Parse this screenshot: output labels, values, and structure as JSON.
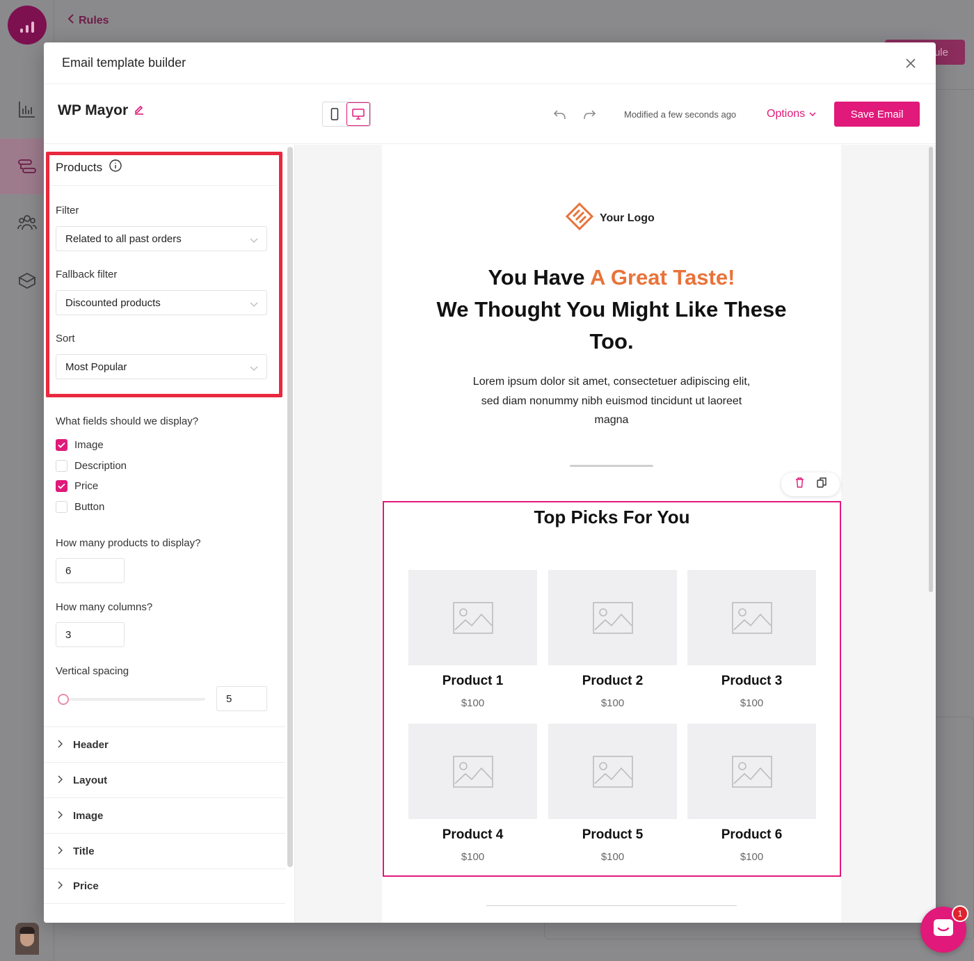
{
  "app": {
    "back_label": "Rules",
    "background_button_partial": "ule"
  },
  "modal": {
    "title": "Email template builder"
  },
  "toolbar": {
    "email_name": "WP Mayor",
    "modified_text": "Modified a few seconds ago",
    "options_label": "Options",
    "save_label": "Save Email",
    "active_view": "desktop"
  },
  "panel": {
    "section_title": "Products",
    "filter_label": "Filter",
    "filter_value": "Related to all past orders",
    "fallback_label": "Fallback filter",
    "fallback_value": "Discounted products",
    "sort_label": "Sort",
    "sort_value": "Most Popular",
    "fields_question": "What fields should we display?",
    "fields": [
      {
        "label": "Image",
        "checked": true
      },
      {
        "label": "Description",
        "checked": false
      },
      {
        "label": "Price",
        "checked": true
      },
      {
        "label": "Button",
        "checked": false
      }
    ],
    "count_label": "How many products to display?",
    "count_value": "6",
    "columns_label": "How many columns?",
    "columns_value": "3",
    "spacing_label": "Vertical spacing",
    "spacing_value": "5",
    "accordions": [
      "Header",
      "Layout",
      "Image",
      "Title",
      "Price"
    ]
  },
  "email": {
    "logo_text": "Your Logo",
    "headline_part1": "You Have ",
    "headline_accent": "A Great Taste!",
    "headline_part2": "We Thought You Might Like These Too.",
    "body_text": "Lorem ipsum dolor sit amet, consectetuer adipiscing elit, sed diam nonummy nibh euismod tincidunt ut laoreet magna",
    "picks_title": "Top Picks For You",
    "products": [
      {
        "name": "Product 1",
        "price": "$100"
      },
      {
        "name": "Product 2",
        "price": "$100"
      },
      {
        "name": "Product 3",
        "price": "$100"
      },
      {
        "name": "Product 4",
        "price": "$100"
      },
      {
        "name": "Product 5",
        "price": "$100"
      },
      {
        "name": "Product 6",
        "price": "$100"
      }
    ]
  },
  "chat": {
    "badge_count": "1"
  },
  "colors": {
    "brand": "#e0197a",
    "accent_orange": "#e8733a",
    "highlight_red": "#e8293e"
  }
}
